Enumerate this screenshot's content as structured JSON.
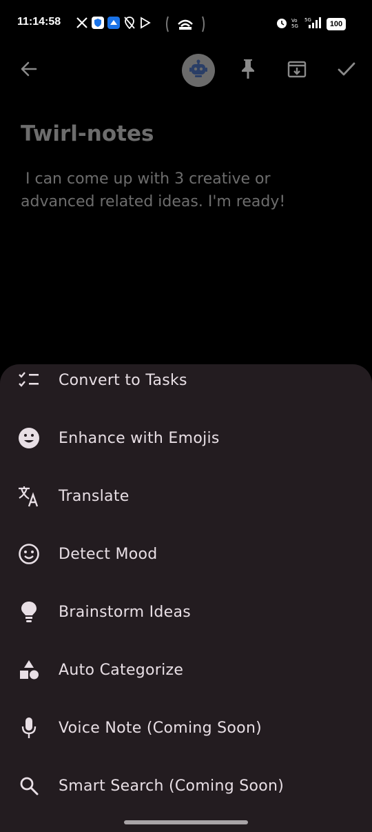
{
  "status_bar": {
    "time": "11:14:58",
    "battery": "100",
    "icons": [
      "x-icon",
      "shield-icon",
      "cloud-icon",
      "location-off-icon",
      "play-icon",
      "hotspot-icon",
      "alarm-icon",
      "volte-icon",
      "signal-icon",
      "battery-icon"
    ]
  },
  "top_bar": {
    "icons": [
      "back-arrow-icon",
      "robot-icon",
      "pin-icon",
      "archive-icon",
      "check-icon"
    ]
  },
  "note": {
    "title": "Twirl-notes",
    "body": " I can come up with 3 creative or advanced related ideas. I'm ready!"
  },
  "sheet": {
    "items": [
      {
        "label": "Convert to Tasks",
        "icon": "checklist-icon"
      },
      {
        "label": "Enhance with Emojis",
        "icon": "emoji-icon"
      },
      {
        "label": "Translate",
        "icon": "translate-icon"
      },
      {
        "label": "Detect Mood",
        "icon": "mood-icon"
      },
      {
        "label": "Brainstorm Ideas",
        "icon": "lightbulb-icon"
      },
      {
        "label": "Auto Categorize",
        "icon": "category-icon"
      },
      {
        "label": "Voice Note (Coming Soon)",
        "icon": "mic-icon"
      },
      {
        "label": "Smart Search (Coming Soon)",
        "icon": "search-icon"
      }
    ]
  },
  "colors": {
    "background": "#000000",
    "sheet": "#231c20",
    "text": "#e8dfe5",
    "muted": "#6d6d6d"
  }
}
